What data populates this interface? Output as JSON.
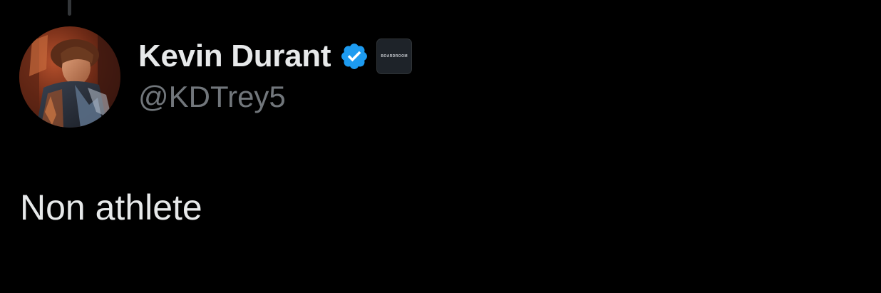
{
  "tweet": {
    "author": {
      "display_name": "Kevin Durant",
      "handle": "@KDTrey5",
      "verified": true,
      "verified_badge_icon": "verified-check-icon",
      "affiliate_badge_text": "BOARDROOM",
      "avatar_icon": "avatar-image"
    },
    "text": "Non athlete"
  },
  "colors": {
    "background": "#000000",
    "primary_text": "#e7e9ea",
    "secondary_text": "#71767b",
    "verified_blue": "#1d9bf0",
    "thread_line": "#333639"
  }
}
